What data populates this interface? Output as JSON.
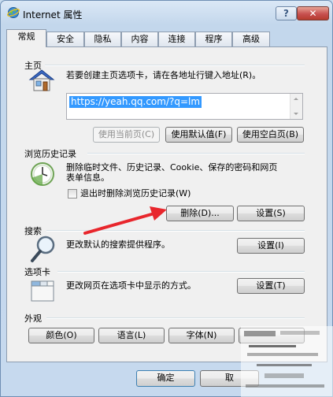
{
  "window": {
    "title": "Internet 属性",
    "help_label": "?",
    "close_label": "✕"
  },
  "tabs": [
    {
      "label": "常规",
      "active": true
    },
    {
      "label": "安全"
    },
    {
      "label": "隐私"
    },
    {
      "label": "内容"
    },
    {
      "label": "连接"
    },
    {
      "label": "程序"
    },
    {
      "label": "高级"
    }
  ],
  "home": {
    "section_label": "主页",
    "description": "若要创建主页选项卡，请在各地址行键入地址(R)。",
    "url": "https://yeah.qq.com/?q=lm",
    "buttons": {
      "use_current": "使用当前页(C)",
      "use_default": "使用默认值(F)",
      "use_blank": "使用空白页(B)"
    },
    "icon": "house-icon"
  },
  "history": {
    "section_label": "浏览历史记录",
    "description_line1": "删除临时文件、历史记录、Cookie、保存的密码和网页",
    "description_line2": "表单信息。",
    "checkbox_label": "退出时删除浏览历史记录(W)",
    "checkbox_checked": false,
    "delete_button": "删除(D)...",
    "settings_button": "设置(S)",
    "icon": "history-clock-icon"
  },
  "search": {
    "section_label": "搜索",
    "description": "更改默认的搜索提供程序。",
    "settings_button": "设置(I)",
    "icon": "magnifier-icon"
  },
  "tabs_section": {
    "section_label": "选项卡",
    "description": "更改网页在选项卡中显示的方式。",
    "settings_button": "设置(T)",
    "icon": "tabs-window-icon"
  },
  "appearance": {
    "section_label": "外观",
    "buttons": {
      "colors": "颜色(O)",
      "languages": "语言(L)",
      "fonts": "字体(N)"
    }
  },
  "footer": {
    "ok_button": "确定",
    "cancel_button": "取"
  },
  "annotation_color": "#e8262c"
}
